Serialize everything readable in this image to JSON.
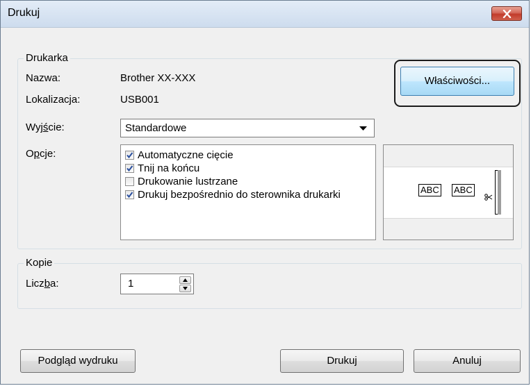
{
  "window": {
    "title": "Drukuj"
  },
  "printer": {
    "legend": "Drukarka",
    "name_label": "Nazwa:",
    "name_value": "Brother XX-XXX",
    "location_label": "Lokalizacja:",
    "location_value": "USB001",
    "properties_button": "Właściwości...",
    "output_label_pre": "Wyj",
    "output_label_accel": "ś",
    "output_label_post": "cie:",
    "output_value": "Standardowe",
    "options_label_pre": "O",
    "options_label_accel": "p",
    "options_label_post": "cje:",
    "options": [
      {
        "label": "Automatyczne cięcie",
        "checked": true
      },
      {
        "label": "Tnij na końcu",
        "checked": true
      },
      {
        "label": "Drukowanie lustrzane",
        "checked": false
      },
      {
        "label": "Drukuj bezpośrednio do sterownika drukarki",
        "checked": true
      }
    ],
    "preview": {
      "label1": "ABC",
      "label2": "ABC"
    }
  },
  "copies": {
    "legend": "Kopie",
    "count_label_pre": "Licz",
    "count_label_accel": "b",
    "count_label_post": "a:",
    "count_value": "1"
  },
  "footer": {
    "preview_btn_pre": "Pod",
    "preview_btn_accel": "g",
    "preview_btn_post": "ląd wydruku",
    "print_button": "Drukuj",
    "cancel_button": "Anuluj"
  }
}
